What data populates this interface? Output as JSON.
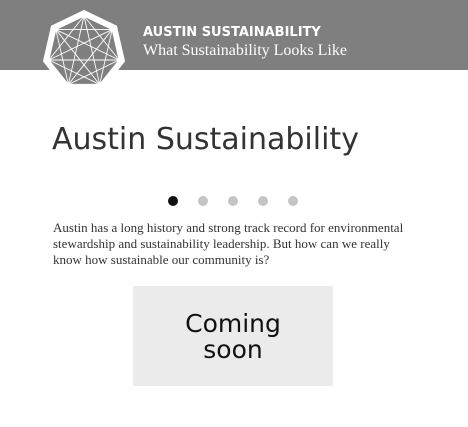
{
  "header": {
    "site_title": "AUSTIN SUSTAINABILITY",
    "tagline": "What Sustainability Looks Like",
    "background_color": "#7f7f7f",
    "logo_icon": "heptagram-logo-icon"
  },
  "main": {
    "title": "Austin Sustainability",
    "carousel": {
      "slide_count": 5,
      "active_slide": 1
    },
    "intro": "Austin has a long history and strong track record for environmental stewardship and sustainability leadership. But how can we really know how sustainable our community is?",
    "placeholder_text": "Coming soon"
  }
}
